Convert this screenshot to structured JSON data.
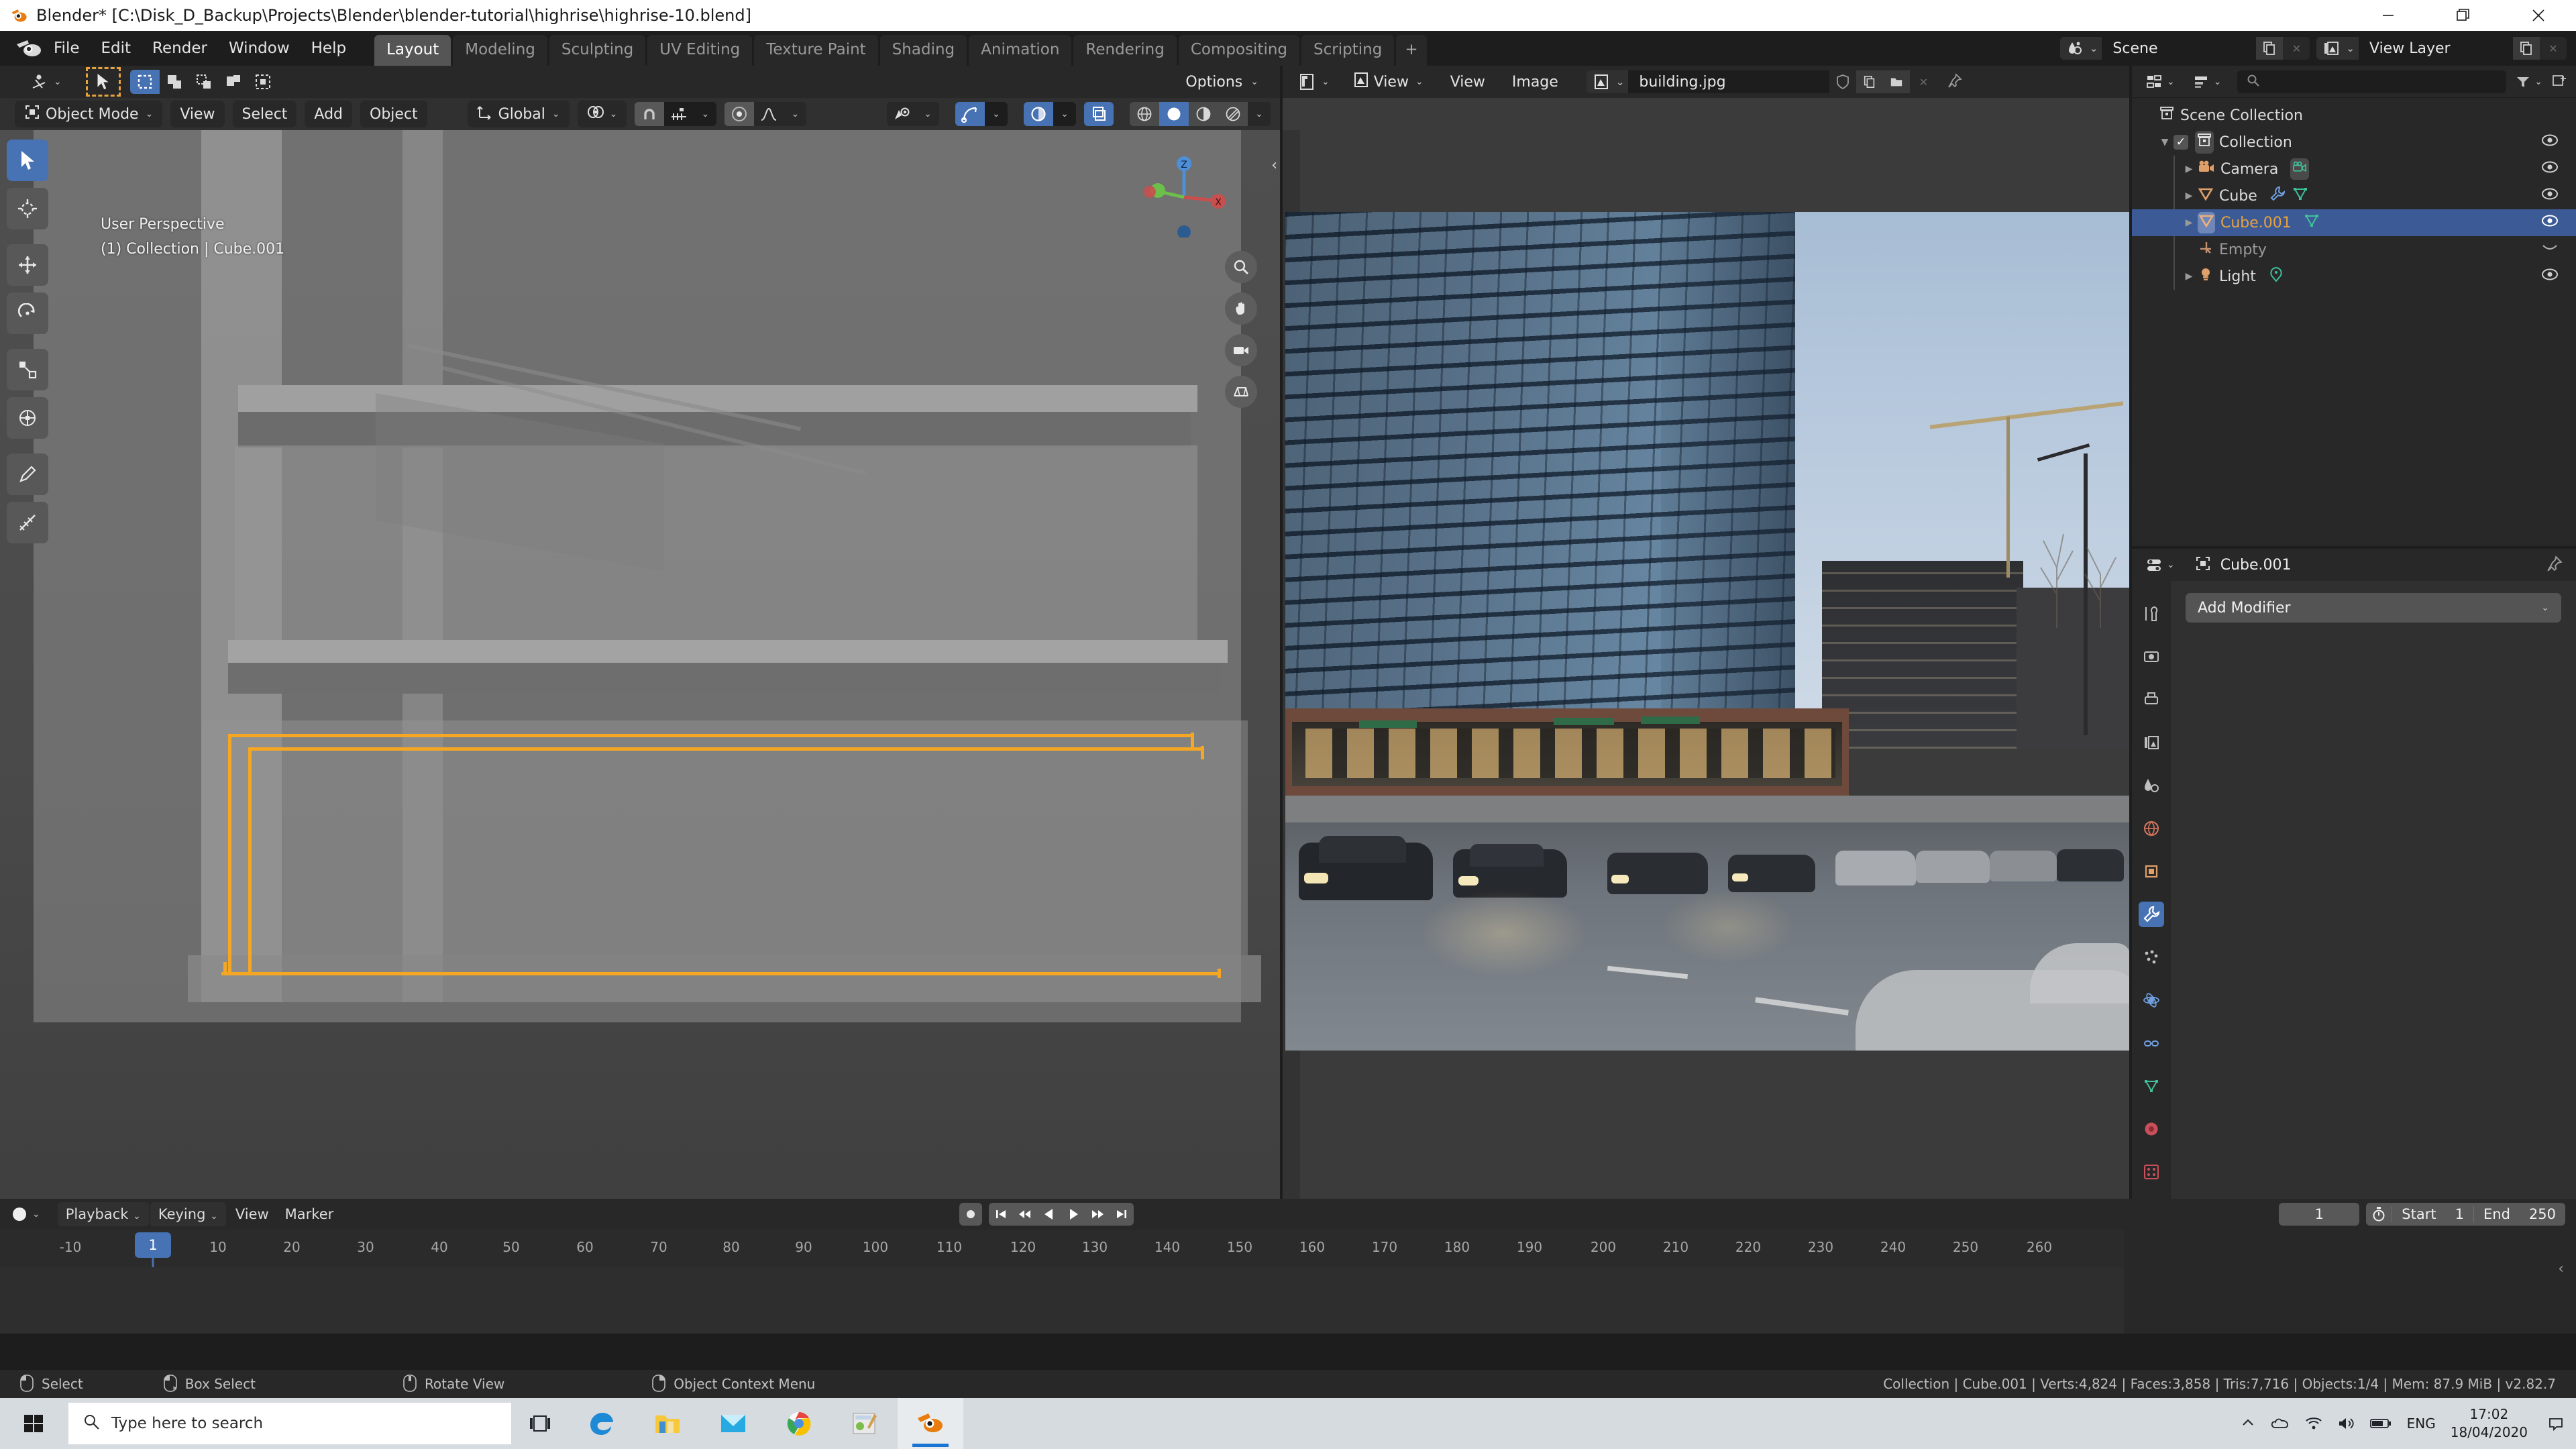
{
  "window": {
    "title": "Blender* [C:\\Disk_D_Backup\\Projects\\Blender\\blender-tutorial\\highrise\\highrise-10.blend]",
    "app_icon": "blender-logo-icon",
    "minimize": "minimize-icon",
    "maximize": "restore-icon",
    "close": "close-icon"
  },
  "topbar": {
    "logo": "blender-logo-icon",
    "menus": [
      "File",
      "Edit",
      "Render",
      "Window",
      "Help"
    ],
    "workspace_tabs": [
      {
        "label": "Layout",
        "active": true
      },
      {
        "label": "Modeling",
        "active": false
      },
      {
        "label": "Sculpting",
        "active": false
      },
      {
        "label": "UV Editing",
        "active": false
      },
      {
        "label": "Texture Paint",
        "active": false
      },
      {
        "label": "Shading",
        "active": false
      },
      {
        "label": "Animation",
        "active": false
      },
      {
        "label": "Rendering",
        "active": false
      },
      {
        "label": "Compositing",
        "active": false
      },
      {
        "label": "Scripting",
        "active": false
      }
    ],
    "add_workspace": "+",
    "scene": {
      "icon": "scene-icon",
      "name": "Scene",
      "new_btn": "new-datablock-icon",
      "unlink_btn": "unlink-icon"
    },
    "view_layer": {
      "icon": "view-layer-icon",
      "name": "View Layer",
      "new_btn": "new-datablock-icon",
      "unlink_btn": "unlink-icon"
    }
  },
  "viewport": {
    "editor_type_icon": "editor-type-3dview-icon",
    "mode": "Object Mode",
    "mode_icon": "object-mode-icon",
    "menus": [
      "View",
      "Select",
      "Add",
      "Object"
    ],
    "transform_orientation": {
      "icon": "orientation-global-icon",
      "label": "Global"
    },
    "snap": {
      "icon": "snap-icon",
      "magnet_icon": "magnet-icon"
    },
    "proportional_edit": {
      "icon": "proportional-edit-icon",
      "falloff_icon": "falloff-smooth-icon"
    },
    "options_label": "Options",
    "select_tools": [
      "tweak-tool-icon",
      "select-box-icon",
      "select-circle-icon",
      "select-lasso-icon",
      "select-intersect-icon"
    ],
    "toolbar_tools": [
      "select-box-tool-icon",
      "cursor-tool-icon",
      "move-tool-icon",
      "rotate-tool-icon",
      "scale-tool-icon",
      "transform-tool-icon",
      "annotate-tool-icon",
      "measure-tool-icon"
    ],
    "shading_modes": [
      "wireframe-icon",
      "solid-icon",
      "material-preview-icon",
      "rendered-icon"
    ],
    "header_right_icons": [
      "visibility-icon",
      "gizmo-icon",
      "overlays-icon",
      "xray-icon"
    ],
    "overlay_text_line1": "User Perspective",
    "overlay_text_line2": "(1) Collection | Cube.001",
    "gizmo_axes": [
      "X",
      "Y",
      "Z"
    ],
    "side_icons": [
      "zoom-icon",
      "hand-pan-icon",
      "camera-view-icon",
      "ortho-persp-icon"
    ]
  },
  "image_editor": {
    "editor_type_icon": "editor-type-image-icon",
    "mode": {
      "icon": "image-mode-icon",
      "label": "View"
    },
    "menus": [
      "View",
      "Image"
    ],
    "image": {
      "icon": "image-datablock-icon",
      "name": "building.jpg",
      "fake_user_btn": "shield-icon",
      "copy_btn": "new-datablock-icon",
      "open_btn": "folder-open-icon",
      "unlink_btn": "close-icon",
      "pin_btn": "pin-icon"
    },
    "alt_text": "Photograph of a glass-clad high-rise building at dusk with street, cars and construction crane"
  },
  "outliner": {
    "editor_type_icon": "editor-type-outliner-icon",
    "display_mode_icon": "display-mode-icon",
    "filter_icon": "filter-icon",
    "search_placeholder": "",
    "search_icon": "search-icon",
    "new_collection_icon": "new-collection-icon",
    "root": "Scene Collection",
    "items": [
      {
        "label": "Scene Collection",
        "icon": "collection-icon",
        "indent": 0,
        "disclosure": "",
        "checkbox": false,
        "eye": false,
        "selected": false,
        "dim": false,
        "extra": []
      },
      {
        "label": "Collection",
        "icon": "collection-icon",
        "indent": 1,
        "disclosure": "down",
        "checkbox": true,
        "eye": true,
        "selected": false,
        "dim": false,
        "extra": []
      },
      {
        "label": "Camera",
        "icon": "camera-object-icon",
        "indent": 2,
        "disclosure": "right",
        "checkbox": false,
        "eye": true,
        "selected": false,
        "dim": false,
        "extra": [
          "camera-data-icon"
        ]
      },
      {
        "label": "Cube",
        "icon": "mesh-object-icon",
        "indent": 2,
        "disclosure": "right",
        "checkbox": false,
        "eye": true,
        "selected": false,
        "dim": false,
        "extra": [
          "modifier-wrench-icon",
          "mesh-data-icon"
        ]
      },
      {
        "label": "Cube.001",
        "icon": "mesh-object-icon",
        "indent": 2,
        "disclosure": "right",
        "checkbox": false,
        "eye": true,
        "selected": true,
        "dim": false,
        "extra": [
          "mesh-data-icon"
        ]
      },
      {
        "label": "Empty",
        "icon": "empty-plain-axes-icon",
        "indent": 2,
        "disclosure": "",
        "checkbox": false,
        "eye": "closed",
        "selected": false,
        "dim": true,
        "extra": []
      },
      {
        "label": "Light",
        "icon": "light-object-icon",
        "indent": 2,
        "disclosure": "right",
        "checkbox": false,
        "eye": true,
        "selected": false,
        "dim": false,
        "extra": [
          "light-data-icon"
        ]
      }
    ]
  },
  "properties": {
    "editor_type_icon": "editor-type-properties-icon",
    "breadcrumb_icon": "object-icon",
    "object_name": "Cube.001",
    "pin_icon": "pin-icon",
    "add_modifier_label": "Add Modifier",
    "add_modifier_chevron": "chevron-down-icon",
    "tabs": [
      "tool-icon",
      "render-icon",
      "output-icon",
      "view-layer-props-icon",
      "scene-props-icon",
      "world-props-icon",
      "object-props-icon",
      "modifier-props-icon",
      "particles-props-icon",
      "physics-props-icon",
      "constraints-props-icon",
      "data-props-icon",
      "material-props-icon",
      "texture-props-icon"
    ],
    "active_tab_index": 7
  },
  "timeline": {
    "editor_type_icon": "editor-type-timeline-icon",
    "menus": [
      {
        "label": "Playback",
        "dropdown": true
      },
      {
        "label": "Keying",
        "dropdown": true
      },
      {
        "label": "View",
        "dropdown": false
      },
      {
        "label": "Marker",
        "dropdown": false
      }
    ],
    "auto_key_icon": "record-icon",
    "transport": [
      "jump-start-icon",
      "prev-keyframe-icon",
      "play-reverse-icon",
      "play-icon",
      "next-keyframe-icon",
      "jump-end-icon"
    ],
    "current_frame": "1",
    "use_preview_range_icon": "stopwatch-icon",
    "start_label": "Start",
    "start_value": "1",
    "end_label": "End",
    "end_value": "250",
    "ruler_ticks": [
      "-10",
      "10",
      "20",
      "30",
      "40",
      "50",
      "60",
      "70",
      "80",
      "90",
      "100",
      "110",
      "120",
      "130",
      "140",
      "150",
      "160",
      "170",
      "180",
      "190",
      "200",
      "210",
      "220",
      "230",
      "240",
      "250",
      "260"
    ],
    "playhead_frame": "1"
  },
  "statusbar": {
    "hints": [
      {
        "icon": "mouse-left-icon",
        "label": "Select"
      },
      {
        "icon": "mouse-left-drag-icon",
        "label": "Box Select"
      },
      {
        "icon": "mouse-middle-icon",
        "label": "Rotate View"
      },
      {
        "icon": "mouse-right-icon",
        "label": "Object Context Menu"
      }
    ],
    "stats": "Collection | Cube.001 | Verts:4,824 | Faces:3,858 | Tris:7,716 | Objects:1/4 | Mem: 87.9 MiB | v2.82.7"
  },
  "taskbar": {
    "start_icon": "windows-start-icon",
    "search_icon": "search-icon",
    "search_placeholder": "Type here to search",
    "task_view_icon": "task-view-icon",
    "apps": [
      {
        "name": "edge-icon",
        "active": false,
        "running": true
      },
      {
        "name": "file-explorer-icon",
        "active": false,
        "running": true
      },
      {
        "name": "mail-icon",
        "active": false,
        "running": false
      },
      {
        "name": "chrome-icon",
        "active": false,
        "running": true
      },
      {
        "name": "paint-icon",
        "active": false,
        "running": true
      },
      {
        "name": "blender-icon",
        "active": true,
        "running": true
      }
    ],
    "tray_icons": [
      "show-hidden-icon",
      "onedrive-icon",
      "network-icon",
      "volume-icon",
      "battery-icon"
    ],
    "language": "ENG",
    "time": "17:02",
    "date": "18/04/2020",
    "notification_icon": "notification-icon"
  },
  "colors": {
    "accent_blue": "#4772b3",
    "select_orange": "#e8a33d",
    "outliner_selected": "#3b5a96",
    "panel_bg": "#303030",
    "header_bg": "#282828",
    "viewport_bg": "#4a4a4a"
  }
}
